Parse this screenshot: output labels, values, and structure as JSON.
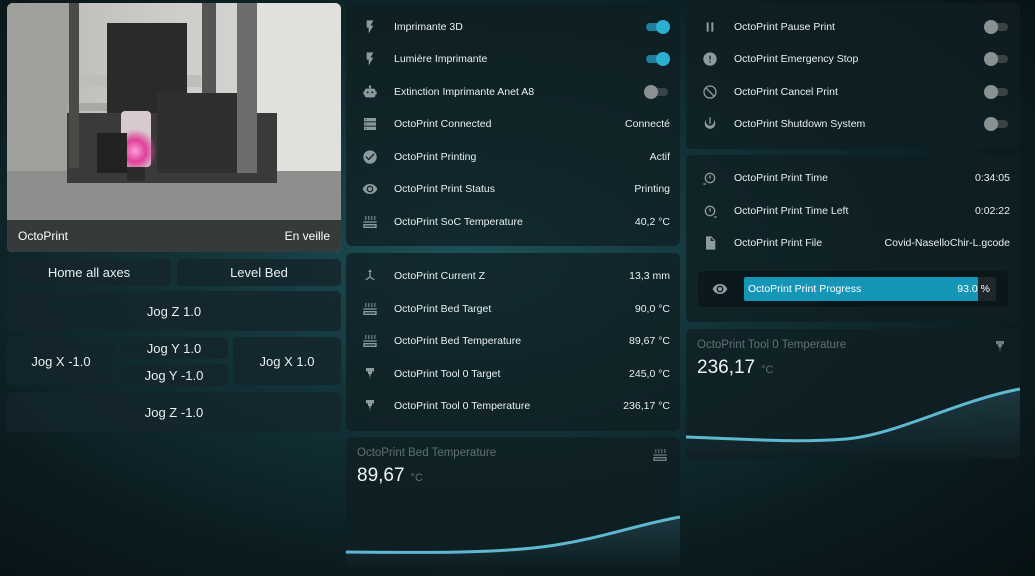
{
  "camera": {
    "name": "OctoPrint",
    "state": "En veille"
  },
  "controls": {
    "home_all": "Home all axes",
    "level_bed": "Level Bed",
    "jog_z_up": "Jog Z 1.0",
    "jog_x_minus": "Jog X -1.0",
    "jog_y_plus": "Jog Y 1.0",
    "jog_y_minus": "Jog Y -1.0",
    "jog_x_plus": "Jog X 1.0",
    "jog_z_down": "Jog Z -1.0"
  },
  "status_card": {
    "rows": [
      {
        "label": "Imprimante 3D",
        "icon": "flash-icon",
        "toggle": true
      },
      {
        "label": "Lumière Imprimante",
        "icon": "flash-icon",
        "toggle": true
      },
      {
        "label": "Extinction Imprimante Anet A8",
        "icon": "robot-icon",
        "toggle": false
      },
      {
        "label": "OctoPrint Connected",
        "icon": "server-icon",
        "value": "Connecté"
      },
      {
        "label": "OctoPrint Printing",
        "icon": "check-circle-icon",
        "value": "Actif"
      },
      {
        "label": "OctoPrint Print Status",
        "icon": "eye-icon",
        "value": "Printing"
      },
      {
        "label": "OctoPrint SoC Temperature",
        "icon": "heat-icon",
        "value": "40,2 °C"
      }
    ]
  },
  "temps_card": {
    "rows": [
      {
        "label": "OctoPrint Current Z",
        "icon": "axis-z-icon",
        "value": "13,3 mm"
      },
      {
        "label": "OctoPrint Bed Target",
        "icon": "heat-icon",
        "value": "90,0 °C"
      },
      {
        "label": "OctoPrint Bed Temperature",
        "icon": "heat-icon",
        "value": "89,67 °C"
      },
      {
        "label": "OctoPrint Tool 0 Target",
        "icon": "nozzle-icon",
        "value": "245,0 °C"
      },
      {
        "label": "OctoPrint Tool 0 Temperature",
        "icon": "nozzle-icon",
        "value": "236,17 °C"
      }
    ]
  },
  "bed_sensor": {
    "name": "OctoPrint Bed Temperature",
    "value": "89,67",
    "unit": "°C",
    "icon": "heat-icon"
  },
  "actions_card": {
    "rows": [
      {
        "label": "OctoPrint Pause Print",
        "icon": "pause-icon",
        "toggle": false
      },
      {
        "label": "OctoPrint Emergency Stop",
        "icon": "alert-circle-icon",
        "toggle": false
      },
      {
        "label": "OctoPrint Cancel Print",
        "icon": "cancel-icon",
        "toggle": false
      },
      {
        "label": "OctoPrint Shutdown System",
        "icon": "power-icon",
        "toggle": false
      }
    ]
  },
  "job_card": {
    "rows": [
      {
        "label": "OctoPrint Print Time",
        "icon": "timer-icon",
        "value": "0:34:05"
      },
      {
        "label": "OctoPrint Print Time Left",
        "icon": "timer-icon",
        "value": "0:02:22"
      },
      {
        "label": "OctoPrint Print File",
        "icon": "file-icon",
        "value": "Covid-NaselloChir-L.gcode"
      }
    ],
    "progress": {
      "label": "OctoPrint Print Progress",
      "value": "93.0 %",
      "fraction": 0.93,
      "icon": "eye-icon"
    }
  },
  "tool_sensor": {
    "name": "OctoPrint Tool 0 Temperature",
    "value": "236,17",
    "unit": "°C",
    "icon": "nozzle-icon"
  },
  "colors": {
    "accent": "#2bb0d4",
    "progress": "#1596b7",
    "graph": "#5fb8cf"
  }
}
